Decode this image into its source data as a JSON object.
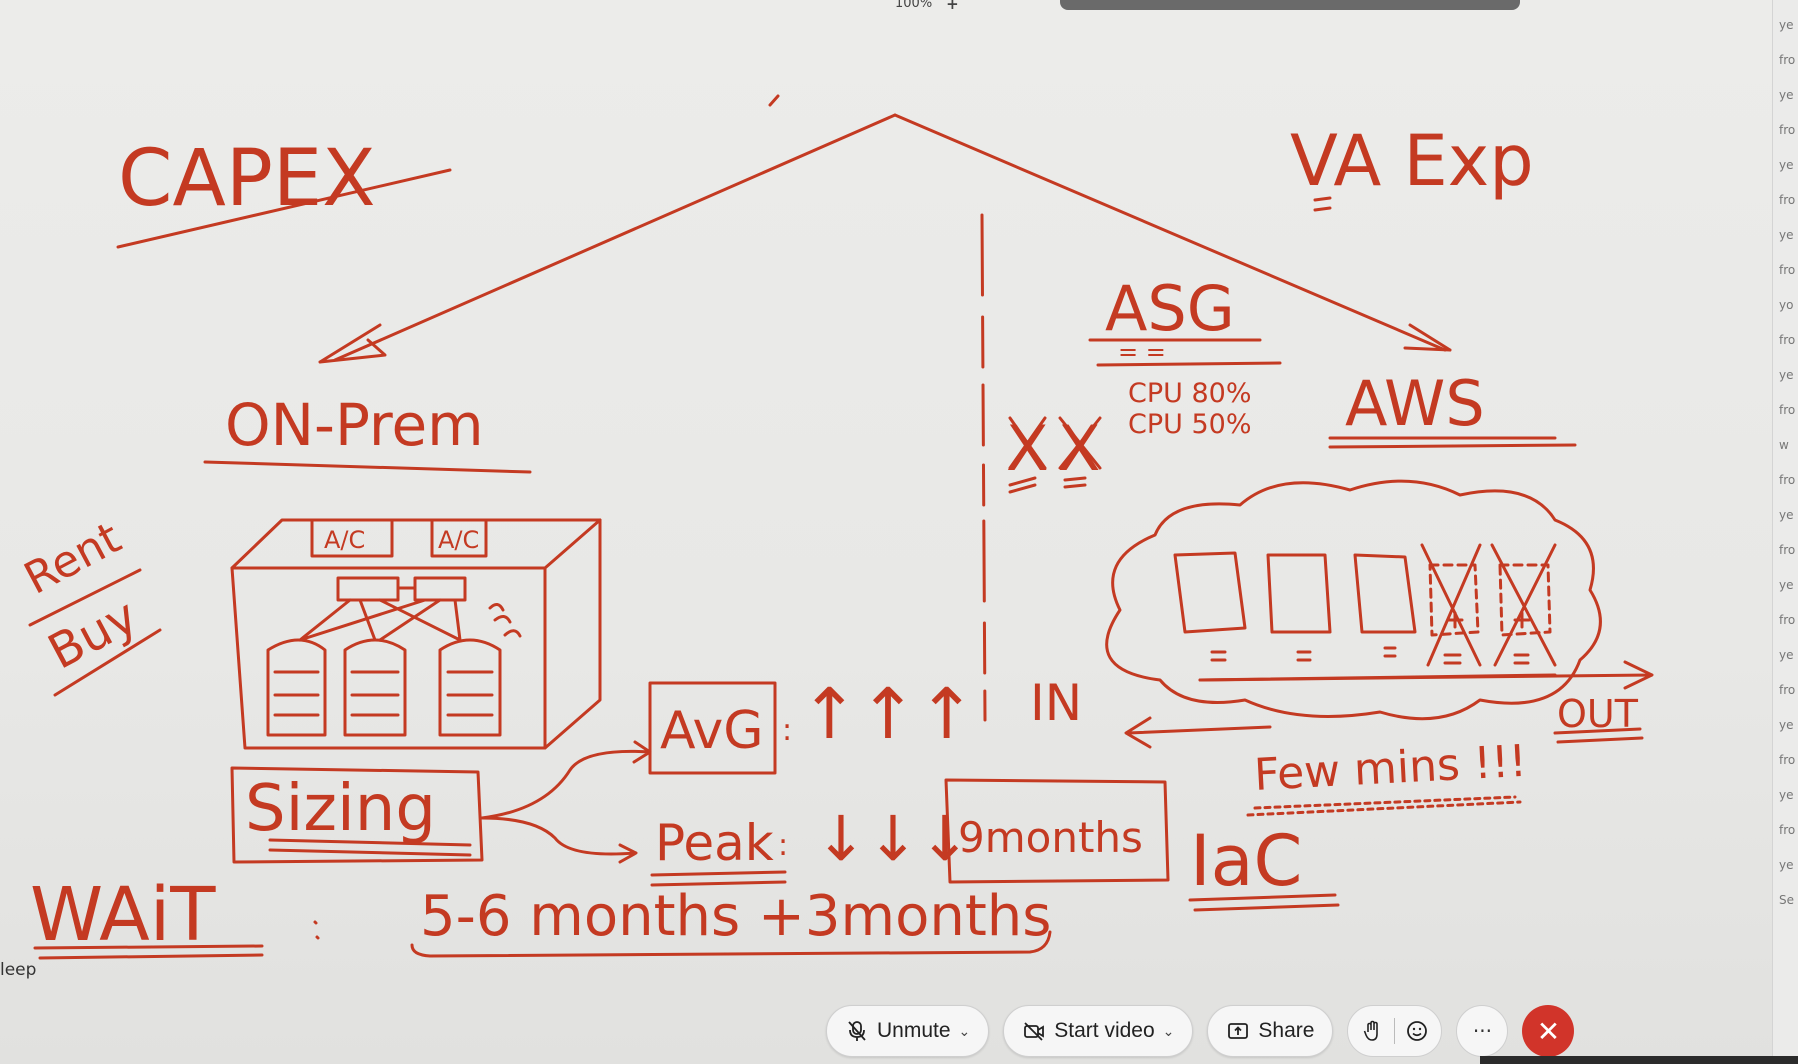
{
  "zoom": {
    "level": "100%",
    "plus": "+"
  },
  "whiteboard": {
    "ink_color": "#c43a22",
    "capex": "CAPEX",
    "va_exp": "VA Exp",
    "on_prem": "ON-Prem",
    "asg": "ASG",
    "asg_marks": "= =",
    "cpu_1": "CPU 80%",
    "cpu_2": "CPU 50%",
    "xx": "XX",
    "xx_marks": "= =",
    "aws": "AWS",
    "rent": "Rent",
    "buy": "Buy",
    "ac_1": "A/C",
    "ac_2": "A/C",
    "avg": "AvG",
    "up_arrows": "↑↑↑",
    "in_label": "IN",
    "out_label": "OUT",
    "few_mins": "Few mins !!!",
    "sizing": "Sizing",
    "peak": "Peak",
    "down_arrows": "↓↓↓",
    "nine_months": "9months",
    "iac": "IaC",
    "wait": "WAiT",
    "wait_time": "5-6 months +3months"
  },
  "sidebar": {
    "label": "leep"
  },
  "chat_strip": {
    "items": [
      "ye",
      "fro",
      "ye",
      "fro",
      "ye",
      "fro",
      "ye",
      "fro",
      "yo",
      "fro",
      "ye",
      "fro",
      "w",
      "fro",
      "ye",
      "fro",
      "ye",
      "fro",
      "ye",
      "fro",
      "ye",
      "fro",
      "ye",
      "fro",
      "ye",
      "Se"
    ]
  },
  "toolbar": {
    "unmute": "Unmute",
    "start_video": "Start video",
    "share": "Share",
    "more": "···",
    "end": "✕"
  }
}
